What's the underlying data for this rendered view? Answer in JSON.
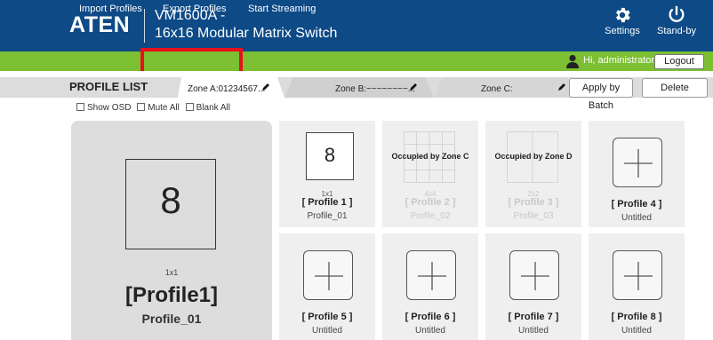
{
  "header": {
    "logo": "ATEN",
    "product_line1": "VM1600A -",
    "product_line2": "16x16 Modular Matrix Switch",
    "settings_label": "Settings",
    "standby_label": "Stand-by",
    "settings_icon": "gear-icon",
    "standby_icon": "power-icon"
  },
  "toolbar": {
    "import": "Import Profiles",
    "export": "Export Profiles",
    "stream": "Start Streaming",
    "greeting": "Hi, administrator.",
    "logout": "Logout",
    "user_icon": "user-icon"
  },
  "profile_list": {
    "title": "PROFILE LIST",
    "zones": [
      {
        "label": "Zone A:01234567..."
      },
      {
        "label": "Zone B:~~~~~~~~..."
      },
      {
        "label": "Zone C:"
      }
    ],
    "apply_batch": "Apply by Batch",
    "delete": "Delete"
  },
  "options": {
    "show_osd": "Show OSD",
    "mute_all": "Mute All",
    "blank_all": "Blank All"
  },
  "preview": {
    "number": "8",
    "layout": "1x1",
    "title": "[Profile1]",
    "subtitle": "Profile_01"
  },
  "cards": [
    {
      "type": "layout",
      "number": "8",
      "layout": "1x1",
      "title": "[ Profile 1 ]",
      "subtitle": "Profile_01"
    },
    {
      "type": "occupied",
      "occupied": "Occupied by Zone C",
      "layout": "4x4",
      "title": "[ Profile 2 ]",
      "subtitle": "Profile_02"
    },
    {
      "type": "occupied",
      "occupied": "Occupied by Zone D",
      "layout": "2x2",
      "title": "[ Profile 3 ]",
      "subtitle": "Profile_03"
    },
    {
      "type": "empty",
      "title": "[ Profile 4 ]",
      "subtitle": "Untitled"
    },
    {
      "type": "empty",
      "title": "[ Profile 5 ]",
      "subtitle": "Untitled"
    },
    {
      "type": "empty",
      "title": "[ Profile 6 ]",
      "subtitle": "Untitled"
    },
    {
      "type": "empty",
      "title": "[ Profile 7 ]",
      "subtitle": "Untitled"
    },
    {
      "type": "empty",
      "title": "[ Profile 8 ]",
      "subtitle": "Untitled"
    }
  ],
  "colors": {
    "header": "#0d4a86",
    "toolbar": "#7cbf32",
    "highlight": "#e8101a"
  }
}
